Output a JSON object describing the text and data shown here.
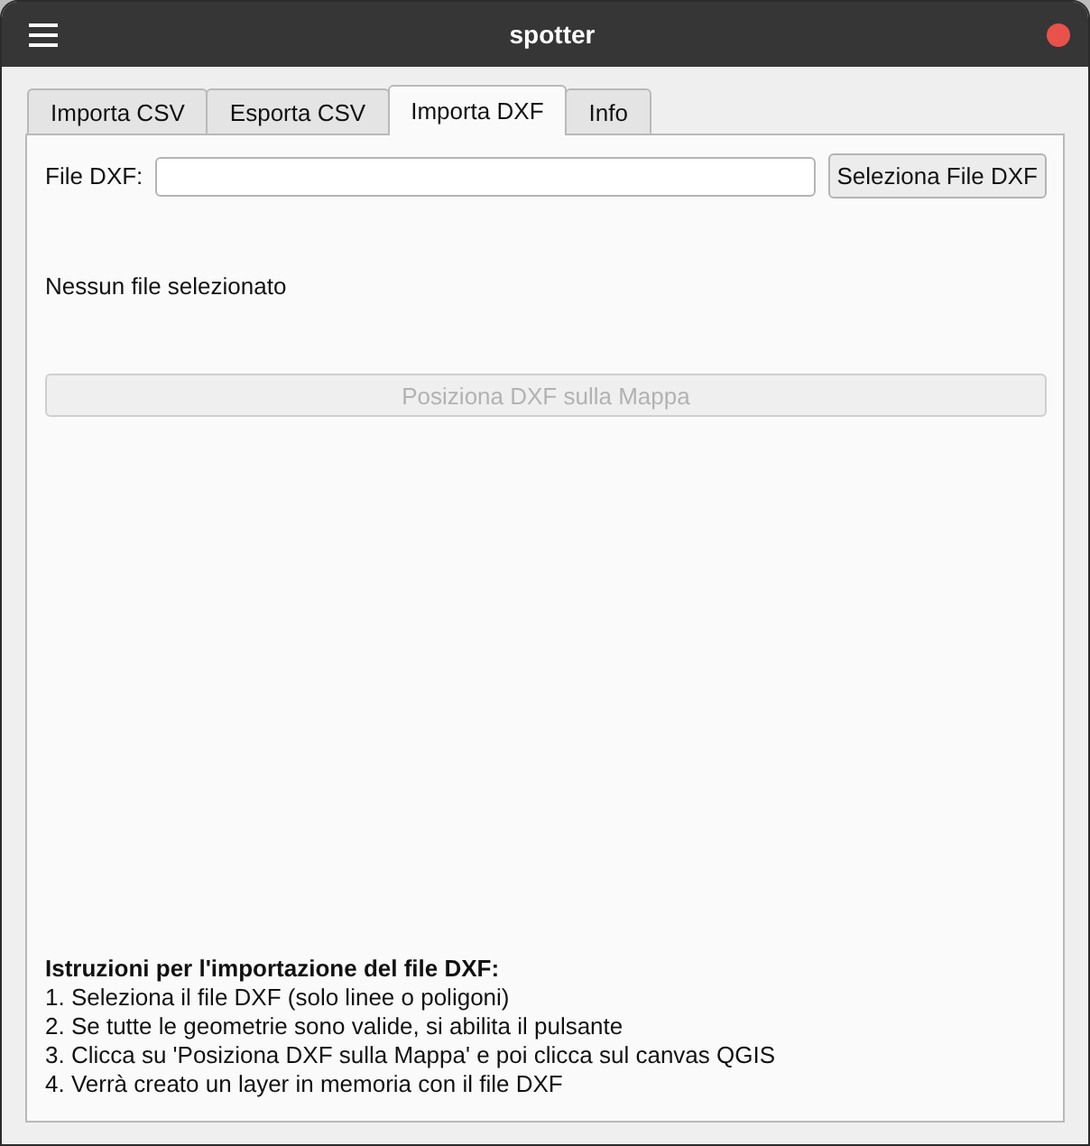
{
  "window": {
    "title": "spotter"
  },
  "tabs": [
    {
      "label": "Importa CSV",
      "selected": false
    },
    {
      "label": "Esporta CSV",
      "selected": false
    },
    {
      "label": "Importa DXF",
      "selected": true
    },
    {
      "label": "Info",
      "selected": false
    }
  ],
  "file_field": {
    "label": "File DXF:"
  },
  "select_button": {
    "label": "Seleziona File DXF",
    "disabled": false
  },
  "status": "Nessun file selezionato",
  "place_button": {
    "label": "Posiziona DXF sulla Mappa",
    "disabled": true
  },
  "instructions": {
    "title": "Istruzioni per l'importazione del file DXF:",
    "lines": [
      "1. Seleziona il file DXF (solo linee o poligoni)",
      "2. Se tutte le geometrie sono valide, si abilita il pulsante",
      "3. Clicca su 'Posiziona DXF sulla Mappa' e poi clicca sul canvas QGIS",
      "4. Verrà creato un layer in memoria con il file DXF"
    ]
  }
}
